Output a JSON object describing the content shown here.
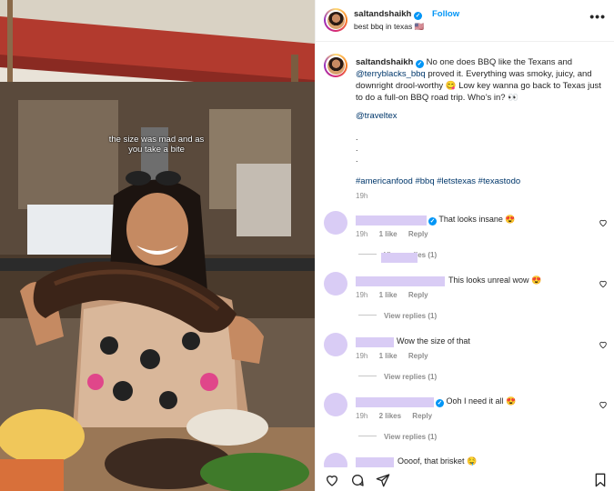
{
  "post": {
    "username": "saltandshaikh",
    "follow_label": "Follow",
    "location": "best bbq in texas 🇺🇸",
    "more_icon": "more-horizontal-icon",
    "overlay_caption": "the size was mad and as you take a bite"
  },
  "caption": {
    "username": "saltandshaikh",
    "text_1": " No one does BBQ like the Texans and ",
    "mention": "@terryblacks_bbq",
    "text_2": " proved it. Everything was smoky, juicy, and downright drool-worthy 😋 Low key wanna go back to Texas just to do a full-on BBQ road trip. Who’s in? 👀",
    "tag_account": "@traveltex",
    "dots": [
      ".",
      ".",
      "."
    ],
    "hashtags": "#americanfood #bbq #letstexas #texastodo",
    "time": "19h"
  },
  "comments": [
    {
      "text": "That looks insane 😍",
      "verified": true,
      "time": "19h",
      "likes": "1 like",
      "reply": "Reply",
      "view_replies": "View replies (1)"
    },
    {
      "text": "This looks unreal wow 😍",
      "verified": false,
      "time": "19h",
      "likes": "1 like",
      "reply": "Reply",
      "view_replies": "View replies (1)"
    },
    {
      "text": "Wow the size of that",
      "verified": false,
      "time": "19h",
      "likes": "1 like",
      "reply": "Reply",
      "view_replies": "View replies (1)"
    },
    {
      "text": "Ooh I need it all 😍",
      "verified": true,
      "time": "19h",
      "likes": "2 likes",
      "reply": "Reply",
      "view_replies": "View replies (1)"
    },
    {
      "text": "Oooof, that brisket 🤤",
      "verified": false,
      "time": "",
      "likes": "",
      "reply": "",
      "view_replies": ""
    }
  ],
  "actions": {
    "icons": [
      "heart-icon",
      "comment-icon",
      "share-icon",
      "bookmark-icon"
    ]
  },
  "colors": {
    "link": "#00376b",
    "follow": "#0095f6",
    "verified": "#0095f6",
    "redacted": "#d9ccf5",
    "meta": "#8e8e8e"
  }
}
